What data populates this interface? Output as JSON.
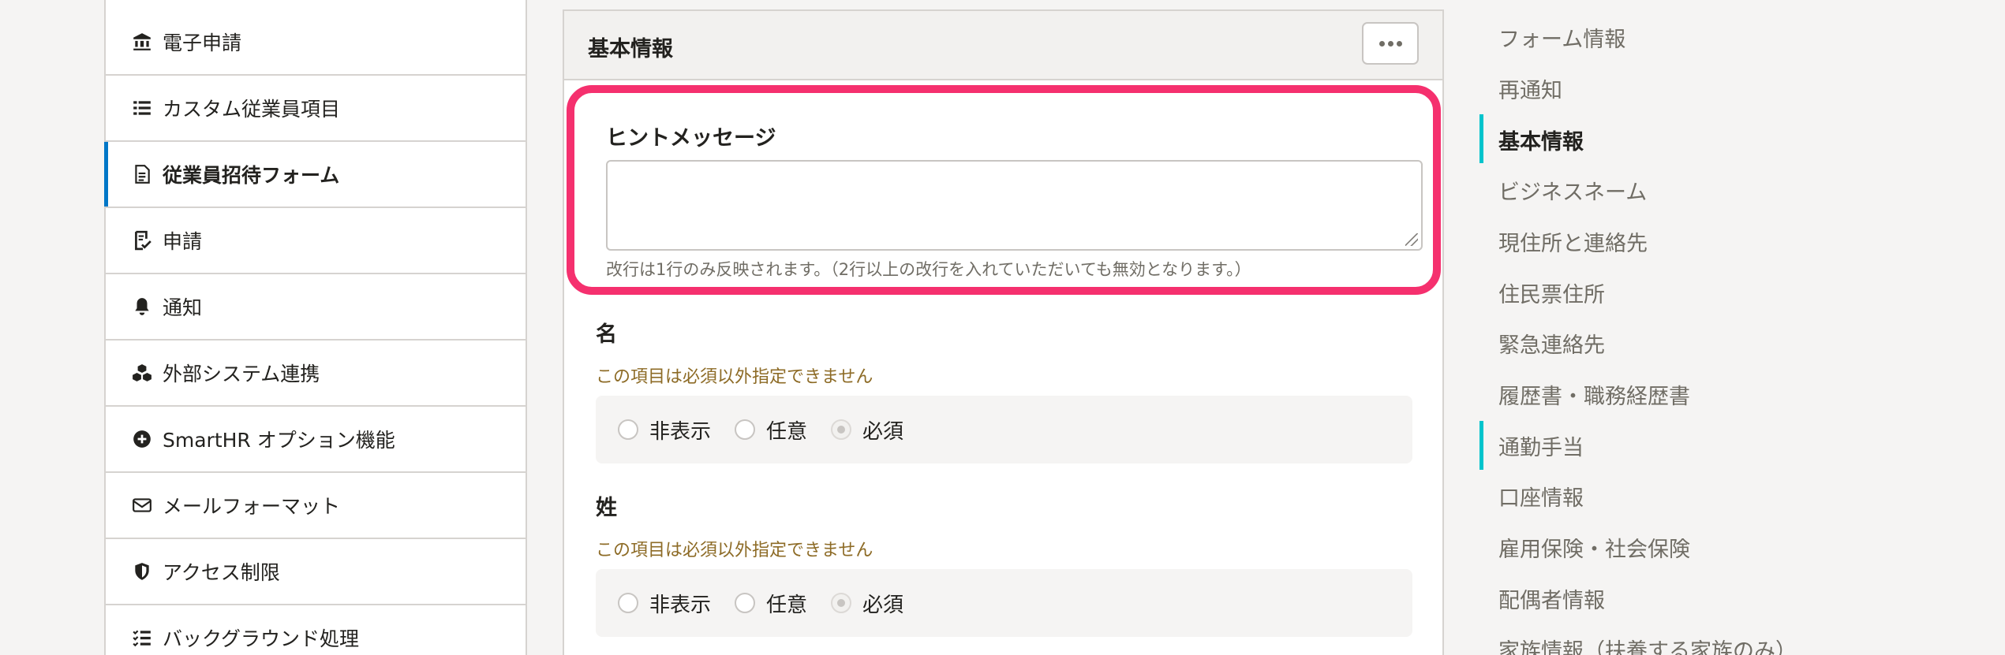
{
  "sidebar": {
    "items": [
      {
        "label": "電子申請",
        "icon": "bank-icon"
      },
      {
        "label": "カスタム従業員項目",
        "icon": "list-icon"
      },
      {
        "label": "従業員招待フォーム",
        "icon": "document-icon",
        "active": true
      },
      {
        "label": "申請",
        "icon": "approval-icon"
      },
      {
        "label": "通知",
        "icon": "bell-icon"
      },
      {
        "label": "外部システム連携",
        "icon": "cubes-icon"
      },
      {
        "label": "SmartHR オプション機能",
        "icon": "plus-circle-icon"
      },
      {
        "label": "メールフォーマット",
        "icon": "envelope-icon"
      },
      {
        "label": "アクセス制限",
        "icon": "shield-icon"
      },
      {
        "label": "バックグラウンド処理",
        "icon": "task-list-icon"
      }
    ]
  },
  "panel": {
    "title": "基本情報",
    "hint": {
      "label": "ヒントメッセージ",
      "value": "",
      "note": "改行は1行のみ反映されます。（2行以上の改行を入れていただいても無効となります。）"
    },
    "fields": [
      {
        "label": "名",
        "warning": "この項目は必須以外指定できません",
        "options": [
          "非表示",
          "任意",
          "必須"
        ],
        "selected": "必須"
      },
      {
        "label": "姓",
        "warning": "この項目は必須以外指定できません",
        "options": [
          "非表示",
          "任意",
          "必須"
        ],
        "selected": "必須"
      }
    ]
  },
  "toc": {
    "items": [
      "フォーム情報",
      "再通知",
      "基本情報",
      "ビジネスネーム",
      "現住所と連絡先",
      "住民票住所",
      "緊急連絡先",
      "履歴書・職務経歴書",
      "通勤手当",
      "口座情報",
      "雇用保険・社会保険",
      "配偶者情報",
      "家族情報（扶養する家族のみ）"
    ],
    "active": "基本情報",
    "marked": [
      "基本情報",
      "通勤手当"
    ]
  },
  "colors": {
    "highlight": "#f5306e",
    "active_nav": "#0077c7",
    "toc_marker": "#00c4cc",
    "warning_text": "#8d6b26"
  }
}
